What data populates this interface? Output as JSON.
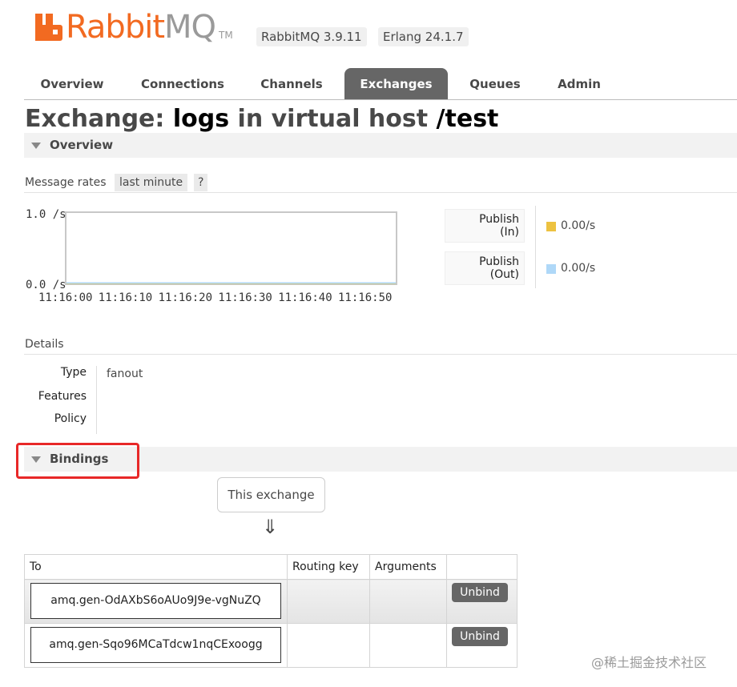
{
  "header": {
    "logo_rabbit": "Rabbit",
    "logo_mq": "MQ",
    "logo_tm": "TM",
    "version": "RabbitMQ 3.9.11",
    "erlang": "Erlang 24.1.7"
  },
  "nav": {
    "tabs": [
      {
        "label": "Overview",
        "active": false
      },
      {
        "label": "Connections",
        "active": false
      },
      {
        "label": "Channels",
        "active": false
      },
      {
        "label": "Exchanges",
        "active": true
      },
      {
        "label": "Queues",
        "active": false
      },
      {
        "label": "Admin",
        "active": false
      }
    ]
  },
  "page": {
    "title_prefix": "Exchange: ",
    "exchange_name": "logs",
    "title_middle": " in virtual host ",
    "vhost": "/test"
  },
  "overview": {
    "section_label": "Overview",
    "message_rates_label": "Message rates",
    "range_label": "last minute",
    "help_label": "?",
    "legend": [
      {
        "line1": "Publish",
        "line2": "(In)",
        "value": "0.00/s",
        "color": "#edc240"
      },
      {
        "line1": "Publish",
        "line2": "(Out)",
        "value": "0.00/s",
        "color": "#afd8f8"
      }
    ]
  },
  "chart_data": {
    "type": "line",
    "x": [
      "11:16:00",
      "11:16:10",
      "11:16:20",
      "11:16:30",
      "11:16:40",
      "11:16:50"
    ],
    "y_ticks": [
      "1.0 /s",
      "0.0 /s"
    ],
    "ylim": [
      0,
      1
    ],
    "series": [
      {
        "name": "Publish (In)",
        "values": [
          0,
          0,
          0,
          0,
          0,
          0
        ],
        "color": "#edc240"
      },
      {
        "name": "Publish (Out)",
        "values": [
          0,
          0,
          0,
          0,
          0,
          0
        ],
        "color": "#afd8f8"
      }
    ]
  },
  "details": {
    "heading": "Details",
    "type_label": "Type",
    "type_value": "fanout",
    "features_label": "Features",
    "policy_label": "Policy"
  },
  "bindings": {
    "section_label": "Bindings",
    "source_label": "This exchange",
    "arrow": "⇓",
    "columns": [
      "To",
      "Routing key",
      "Arguments"
    ],
    "rows": [
      {
        "to": "amq.gen-OdAXbS6oAUo9J9e-vgNuZQ",
        "routing_key": "",
        "arguments": "",
        "action": "Unbind"
      },
      {
        "to": "amq.gen-Sqo96MCaTdcw1nqCExoogg",
        "routing_key": "",
        "arguments": "",
        "action": "Unbind"
      }
    ]
  },
  "watermark": "@稀土掘金技术社区"
}
